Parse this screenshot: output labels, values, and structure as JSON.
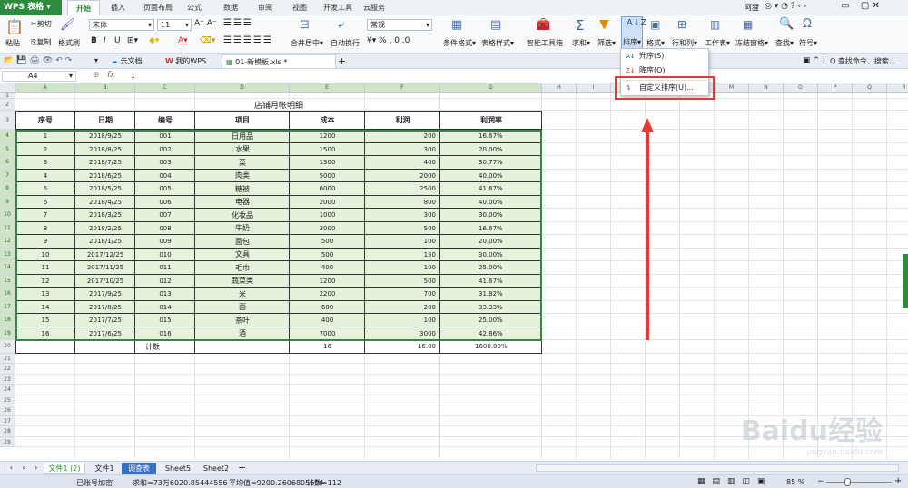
{
  "app": {
    "name": "WPS 表格",
    "user": "阿狸"
  },
  "menu_tabs": [
    "开始",
    "插入",
    "页面布局",
    "公式",
    "数据",
    "审阅",
    "视图",
    "开发工具",
    "云服务"
  ],
  "ribbon": {
    "paste": "粘贴",
    "cut": "剪切",
    "copy": "复制",
    "format_painter": "格式刷",
    "font_name": "宋体",
    "font_size": "11",
    "merge_center": "合并居中",
    "wrap_text": "自动换行",
    "number_format": "常规",
    "cond_format": "条件格式",
    "table_style": "表格样式",
    "smart_toolbox": "智能工具箱",
    "sum": "求和",
    "filter": "筛选",
    "sort": "排序",
    "format": "格式",
    "row_col": "行和列",
    "worksheet": "工作表",
    "freeze": "冻结窗格",
    "find": "查找",
    "symbol": "符号"
  },
  "doc_tabs": {
    "cloud_docs": "云文档",
    "my_wps": "我的WPS",
    "current_file": "01-新模板.xls *",
    "search_placeholder": "查找命令、搜索..."
  },
  "formula_bar": {
    "cell_ref": "A4",
    "fx": "fx",
    "value": "1"
  },
  "dropdown": {
    "asc": "升序(S)",
    "desc": "降序(O)",
    "custom": "自定义排序(U)..."
  },
  "columns": [
    "A",
    "B",
    "C",
    "D",
    "E",
    "F",
    "G",
    "H",
    "I",
    "J",
    "K",
    "L",
    "M",
    "N",
    "O",
    "P",
    "Q",
    "R"
  ],
  "sheet": {
    "title": "店铺月帐明细",
    "headers": [
      "序号",
      "日期",
      "编号",
      "项目",
      "成本",
      "利润",
      "利润率"
    ],
    "rows": [
      [
        "1",
        "2018/9/25",
        "001",
        "日用品",
        "1200",
        "200",
        "16.67%"
      ],
      [
        "2",
        "2018/8/25",
        "002",
        "水果",
        "1500",
        "300",
        "20.00%"
      ],
      [
        "3",
        "2018/7/25",
        "003",
        "菜",
        "1300",
        "400",
        "30.77%"
      ],
      [
        "4",
        "2018/6/25",
        "004",
        "肉类",
        "5000",
        "2000",
        "40.00%"
      ],
      [
        "5",
        "2018/5/25",
        "005",
        "糖被",
        "6000",
        "2500",
        "41.67%"
      ],
      [
        "6",
        "2018/4/25",
        "006",
        "电器",
        "2000",
        "800",
        "40.00%"
      ],
      [
        "7",
        "2018/3/25",
        "007",
        "化妆品",
        "1000",
        "300",
        "30.00%"
      ],
      [
        "8",
        "2018/2/25",
        "008",
        "牛奶",
        "3000",
        "500",
        "16.67%"
      ],
      [
        "9",
        "2018/1/25",
        "009",
        "面包",
        "500",
        "100",
        "20.00%"
      ],
      [
        "10",
        "2017/12/25",
        "010",
        "文具",
        "500",
        "150",
        "30.00%"
      ],
      [
        "11",
        "2017/11/25",
        "011",
        "毛巾",
        "400",
        "100",
        "25.00%"
      ],
      [
        "12",
        "2017/10/25",
        "012",
        "蔬菜类",
        "1200",
        "500",
        "41.67%"
      ],
      [
        "13",
        "2017/9/25",
        "013",
        "米",
        "2200",
        "700",
        "31.82%"
      ],
      [
        "14",
        "2017/8/25",
        "014",
        "面",
        "600",
        "200",
        "33.33%"
      ],
      [
        "15",
        "2017/7/25",
        "015",
        "茶叶",
        "400",
        "100",
        "25.00%"
      ],
      [
        "16",
        "2017/6/25",
        "016",
        "酒",
        "7000",
        "3000",
        "42.86%"
      ]
    ],
    "total": {
      "label": "计数",
      "cost": "16",
      "profit": "16.00",
      "rate": "1600.00%"
    }
  },
  "sheet_tabs": [
    "文件1 (2)",
    "文件1",
    "调查表",
    "Sheet5",
    "Sheet2"
  ],
  "status": {
    "backup": "已账号加密",
    "sum": "求和=73万6020.85444556",
    "avg": "平均值=9200.2606805694",
    "count": "计数=112",
    "zoom": "85 %"
  },
  "watermark": "Baidu经验",
  "watermark_url": "jingyan.baidu.com",
  "colors": {
    "accent": "#2e8b3d",
    "selection_fill": "#e4f2dc",
    "highlight": "#e53935"
  }
}
